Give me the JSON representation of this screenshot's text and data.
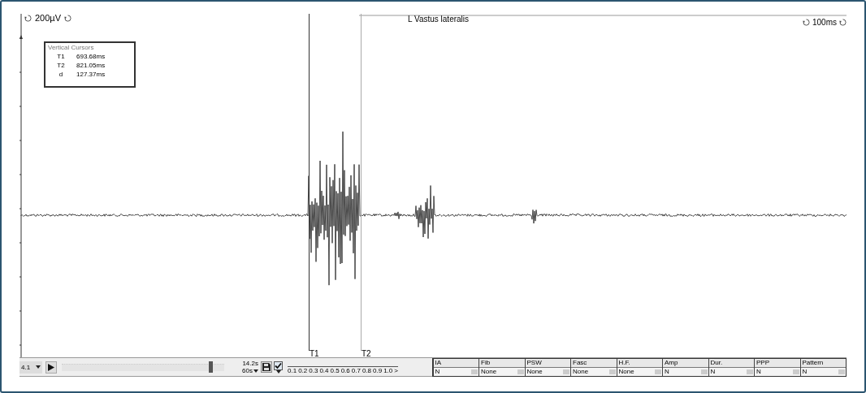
{
  "scales": {
    "amplitude": "200µV",
    "sweep": "100ms"
  },
  "channel": "L Vastus lateralis",
  "cursor_panel": {
    "title": "Vertical Cursors",
    "rows": [
      {
        "label": "T1",
        "value": "693.68ms"
      },
      {
        "label": "T2",
        "value": "821.05ms"
      },
      {
        "label": "d",
        "value": "127.37ms"
      }
    ]
  },
  "cursors": [
    {
      "label": "T1"
    },
    {
      "label": "T2"
    }
  ],
  "toolbar": {
    "gain": "4.1",
    "level": 0.93,
    "time": "14.2s",
    "duration": "60s",
    "checked": true,
    "scale_ticks": [
      "0.1",
      "0.2",
      "0.3",
      "0.4",
      "0.5",
      "0.6",
      "0.7",
      "0.8",
      "0.9",
      "1.0"
    ],
    "scale_more": ">"
  },
  "classification": [
    {
      "label": "IA",
      "value": "N"
    },
    {
      "label": "Fib",
      "value": "None"
    },
    {
      "label": "PSW",
      "value": "None"
    },
    {
      "label": "Fasc",
      "value": "None"
    },
    {
      "label": "H.F.",
      "value": "None"
    },
    {
      "label": "Amp",
      "value": "N"
    },
    {
      "label": "Dur.",
      "value": "N"
    },
    {
      "label": "PPP",
      "value": "N"
    },
    {
      "label": "Pattern",
      "value": "N"
    }
  ]
}
